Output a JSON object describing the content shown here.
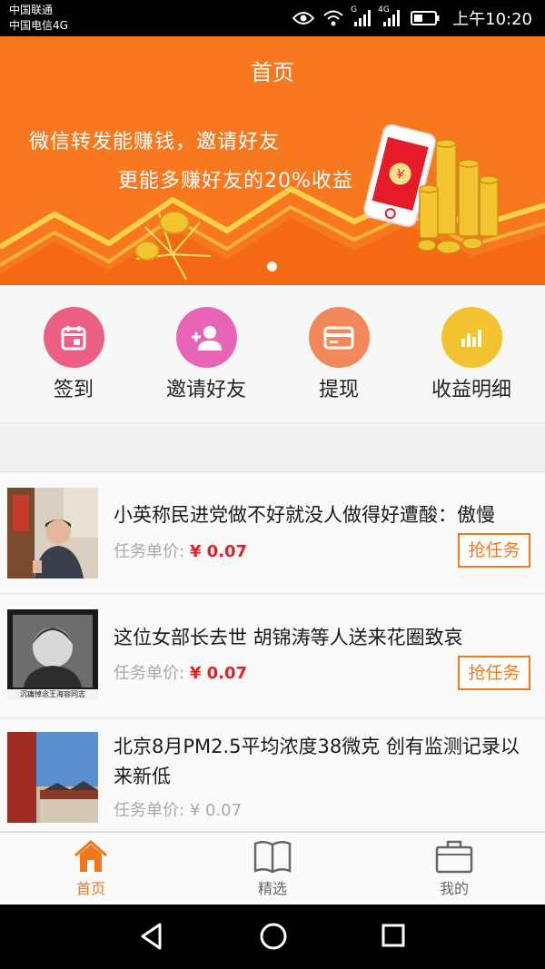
{
  "status_bar": {
    "carrier1": "中国联通",
    "carrier2": "中国电信4G",
    "network1": "G",
    "network2": "4G",
    "time": "上午10:20"
  },
  "banner": {
    "title": "首页",
    "line1": "微信转发能赚钱，邀请好友",
    "line2": "更能多赚好友的20%收益",
    "colors": {
      "background": "#f7781e",
      "gold": "#f4c430"
    }
  },
  "quick_actions": [
    {
      "label": "签到",
      "icon": "calendar-icon",
      "color": "#ec5f83"
    },
    {
      "label": "邀请好友",
      "icon": "add-user-icon",
      "color": "#e864b6"
    },
    {
      "label": "提现",
      "icon": "card-icon",
      "color": "#f2885a"
    },
    {
      "label": "收益明细",
      "icon": "bar-chart-icon",
      "color": "#f2c230"
    }
  ],
  "news": [
    {
      "title": "小英称民进党做不好就没人做得好遭酸：傲慢",
      "price_label": "任务单价:",
      "price": "¥ 0.07",
      "button": "抢任务"
    },
    {
      "title": "这位女部长去世 胡锦涛等人送来花圈致哀",
      "price_label": "任务单价:",
      "price": "¥ 0.07",
      "button": "抢任务",
      "thumb_caption": "沉痛悼念王海容同志"
    },
    {
      "title": "北京8月PM2.5平均浓度38微克 创有监测记录以来新低",
      "price_label": "任务单价:",
      "price": "¥ 0.07"
    }
  ],
  "tabs": [
    {
      "label": "首页",
      "icon": "home-icon",
      "active": true
    },
    {
      "label": "精选",
      "icon": "book-icon",
      "active": false
    },
    {
      "label": "我的",
      "icon": "briefcase-icon",
      "active": false
    }
  ],
  "nav": {
    "icons": [
      "back-icon",
      "home-circle-icon",
      "recents-icon"
    ]
  },
  "colors": {
    "accent": "#f0791f",
    "price": "#e02222"
  }
}
